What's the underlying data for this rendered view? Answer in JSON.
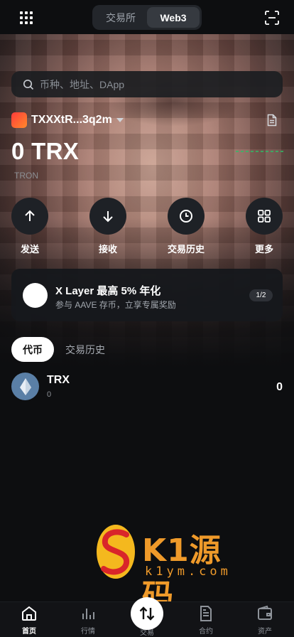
{
  "header": {
    "segments": [
      "交易所",
      "Web3"
    ],
    "active_segment": "Web3"
  },
  "search": {
    "placeholder": "币种、地址、DApp"
  },
  "wallet": {
    "name": "TXXXtR...3q2m",
    "balance": "0 TRX",
    "chain": "TRON"
  },
  "actions": [
    {
      "label": "发送",
      "icon": "arrow-up-icon"
    },
    {
      "label": "接收",
      "icon": "arrow-down-icon"
    },
    {
      "label": "交易历史",
      "icon": "clock-icon"
    },
    {
      "label": "更多",
      "icon": "grid-icon"
    }
  ],
  "banner": {
    "title": "X Layer 最高 5% 年化",
    "subtitle": "参与 AAVE 存币，立享专属奖励",
    "pager": "1/2"
  },
  "tabs": [
    "代币",
    "交易历史"
  ],
  "tokens": [
    {
      "symbol": "TRX",
      "sub": "0",
      "amount": "0"
    }
  ],
  "watermark": {
    "title": "K1源码",
    "url": "k1ym.com"
  },
  "bottom_nav": [
    "首页",
    "行情",
    "交易",
    "合约",
    "资产"
  ],
  "colors": {
    "background": "#0d0e10",
    "accent_positive": "#2ebd67",
    "watermark": "#ef9a2a"
  }
}
